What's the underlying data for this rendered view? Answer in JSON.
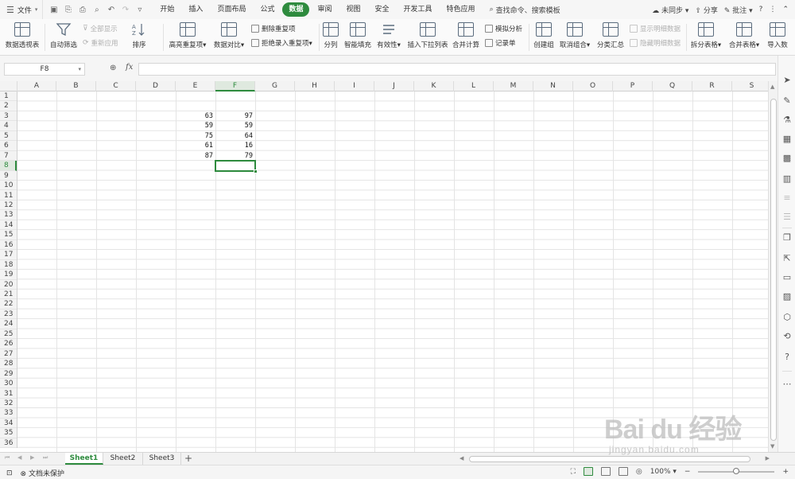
{
  "menubar": {
    "file_label": "文件",
    "tabs": [
      {
        "label": "开始",
        "active": false
      },
      {
        "label": "插入",
        "active": false
      },
      {
        "label": "页面布局",
        "active": false
      },
      {
        "label": "公式",
        "active": false
      },
      {
        "label": "数据",
        "active": true
      },
      {
        "label": "审阅",
        "active": false
      },
      {
        "label": "视图",
        "active": false
      },
      {
        "label": "安全",
        "active": false
      },
      {
        "label": "开发工具",
        "active": false
      },
      {
        "label": "特色应用",
        "active": false
      }
    ],
    "search_label": "查找命令、搜索模板",
    "sync_label": "未同步",
    "share_label": "分享",
    "comment_label": "批注",
    "help_label": "?",
    "accent_color": "#2e8b3e"
  },
  "ribbon": {
    "pivot": "数据透视表",
    "autofilter": "自动筛选",
    "show_all": "全部显示",
    "reapply": "重新应用",
    "sort": "排序",
    "highlight_dup": "高亮重复项",
    "data_compare": "数据对比",
    "remove_dup": "删除重复项",
    "reject_dup": "拒绝录入重复项",
    "split_col": "分列",
    "smart_fill": "智能填充",
    "validity": "有效性",
    "insert_dropdown": "插入下拉列表",
    "consolidate": "合并计算",
    "simulate": "模拟分析",
    "record": "记录单",
    "create_group": "创建组",
    "ungroup": "取消组合",
    "subtotal": "分类汇总",
    "show_detail": "显示明细数据",
    "hide_detail": "隐藏明细数据",
    "split_table": "拆分表格",
    "merge_table": "合并表格",
    "import_data": "导入数"
  },
  "formula": {
    "name_box": "F8",
    "fx_label": "fx",
    "content": ""
  },
  "grid": {
    "columns": [
      "A",
      "B",
      "C",
      "D",
      "E",
      "F",
      "G",
      "H",
      "I",
      "J",
      "K",
      "L",
      "M",
      "N",
      "O",
      "P",
      "Q",
      "R",
      "S"
    ],
    "rows": [
      "1",
      "2",
      "3",
      "4",
      "5",
      "6",
      "7",
      "8",
      "9",
      "10",
      "11",
      "12",
      "13",
      "14",
      "15",
      "16",
      "17",
      "18",
      "19",
      "20",
      "21",
      "22",
      "23",
      "24",
      "25",
      "26",
      "27",
      "28",
      "29",
      "30",
      "31",
      "32",
      "33",
      "34",
      "35",
      "36"
    ],
    "selected_column": "F",
    "selected_row": "8",
    "cells": [
      {
        "ref": "E3",
        "col": 4,
        "row": 2,
        "value": "63"
      },
      {
        "ref": "F3",
        "col": 5,
        "row": 2,
        "value": "97"
      },
      {
        "ref": "E4",
        "col": 4,
        "row": 3,
        "value": "59"
      },
      {
        "ref": "F4",
        "col": 5,
        "row": 3,
        "value": "59"
      },
      {
        "ref": "E5",
        "col": 4,
        "row": 4,
        "value": "75"
      },
      {
        "ref": "F5",
        "col": 5,
        "row": 4,
        "value": "64"
      },
      {
        "ref": "E6",
        "col": 4,
        "row": 5,
        "value": "61"
      },
      {
        "ref": "F6",
        "col": 5,
        "row": 5,
        "value": "16"
      },
      {
        "ref": "E7",
        "col": 4,
        "row": 6,
        "value": "87"
      },
      {
        "ref": "F7",
        "col": 5,
        "row": 6,
        "value": "79"
      }
    ],
    "active_cell": {
      "ref": "F8",
      "col": 5,
      "row": 7
    }
  },
  "sheets": [
    {
      "label": "Sheet1",
      "active": true
    },
    {
      "label": "Sheet2",
      "active": false
    },
    {
      "label": "Sheet3",
      "active": false
    }
  ],
  "statusbar": {
    "protect_label": "文档未保护",
    "zoom_label": "100%"
  },
  "watermark": {
    "logo_text": "Bai du 经验",
    "url_text": "jingyan.baidu.com"
  }
}
